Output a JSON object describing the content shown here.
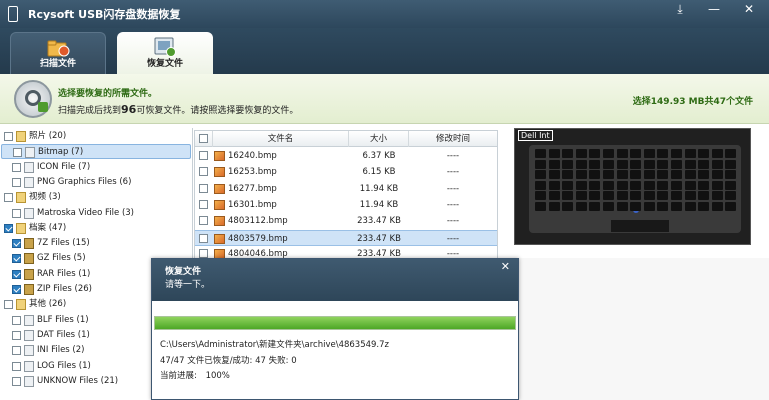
{
  "window": {
    "title": "Rcysoft USB闪存盘数据恢复",
    "buttons": {
      "pin": "⤓",
      "minimize": "—",
      "close": "✕"
    }
  },
  "tabs": [
    {
      "label": "扫描文件",
      "icon": "scan-folder-icon"
    },
    {
      "label": "恢复文件",
      "icon": "recover-files-icon"
    }
  ],
  "banner": {
    "heading": "选择要恢复的所需文件。",
    "sub_prefix": "扫描完成后找到",
    "sub_count": "96",
    "sub_suffix": "可恢复文件。请按照选择要恢复的文件。",
    "summary": "选择149.93 MB共47个文件",
    "accent_color": "#2e6b14"
  },
  "tree": {
    "items": [
      {
        "label": "照片 (20)",
        "level": 0,
        "checked": false,
        "kind": "group"
      },
      {
        "label": "Bitmap (7)",
        "level": 1,
        "checked": false,
        "kind": "image",
        "selected": true
      },
      {
        "label": "ICON File (7)",
        "level": 1,
        "checked": false,
        "kind": "image"
      },
      {
        "label": "PNG Graphics Files (6)",
        "level": 1,
        "checked": false,
        "kind": "image"
      },
      {
        "label": "视频 (3)",
        "level": 0,
        "checked": false,
        "kind": "group"
      },
      {
        "label": "Matroska Video File (3)",
        "level": 1,
        "checked": false,
        "kind": "doc"
      },
      {
        "label": "档案 (47)",
        "level": 0,
        "checked": true,
        "kind": "group"
      },
      {
        "label": "7Z Files (15)",
        "level": 1,
        "checked": true,
        "kind": "archive"
      },
      {
        "label": "GZ Files (5)",
        "level": 1,
        "checked": true,
        "kind": "archive"
      },
      {
        "label": "RAR Files (1)",
        "level": 1,
        "checked": true,
        "kind": "archive"
      },
      {
        "label": "ZIP Files (26)",
        "level": 1,
        "checked": true,
        "kind": "archive"
      },
      {
        "label": "其他 (26)",
        "level": 0,
        "checked": false,
        "kind": "group"
      },
      {
        "label": "BLF Files (1)",
        "level": 1,
        "checked": false,
        "kind": "doc"
      },
      {
        "label": "DAT Files (1)",
        "level": 1,
        "checked": false,
        "kind": "doc"
      },
      {
        "label": "INI Files (2)",
        "level": 1,
        "checked": false,
        "kind": "doc"
      },
      {
        "label": "LOG Files (1)",
        "level": 1,
        "checked": false,
        "kind": "doc"
      },
      {
        "label": "UNKNOW Files (21)",
        "level": 1,
        "checked": false,
        "kind": "doc"
      }
    ]
  },
  "table": {
    "columns": [
      "文件名",
      "大小",
      "修改时间"
    ],
    "rows": [
      {
        "name": "16240.bmp",
        "size": "6.37 KB",
        "modified": "----"
      },
      {
        "name": "16253.bmp",
        "size": "6.15 KB",
        "modified": "----"
      },
      {
        "name": "16277.bmp",
        "size": "11.94 KB",
        "modified": "----"
      },
      {
        "name": "16301.bmp",
        "size": "11.94 KB",
        "modified": "----"
      },
      {
        "name": "4803112.bmp",
        "size": "233.47 KB",
        "modified": "----"
      },
      {
        "name": "4803579.bmp",
        "size": "233.47 KB",
        "modified": "----",
        "selected": true
      },
      {
        "name": "4804046.bmp",
        "size": "233.47 KB",
        "modified": "----"
      }
    ]
  },
  "preview": {
    "caption": "Dell Int"
  },
  "dialog": {
    "title": "恢复文件",
    "subtitle": "请等一下。",
    "close": "✕",
    "progress": 1.0,
    "path": "C:\\Users\\Administrator\\新建文件夹\\archive\\4863549.7z",
    "status": "47/47 文件已恢复/成功: 47 失败: 0",
    "current_label": "当前进展:",
    "current_value": "100%"
  }
}
